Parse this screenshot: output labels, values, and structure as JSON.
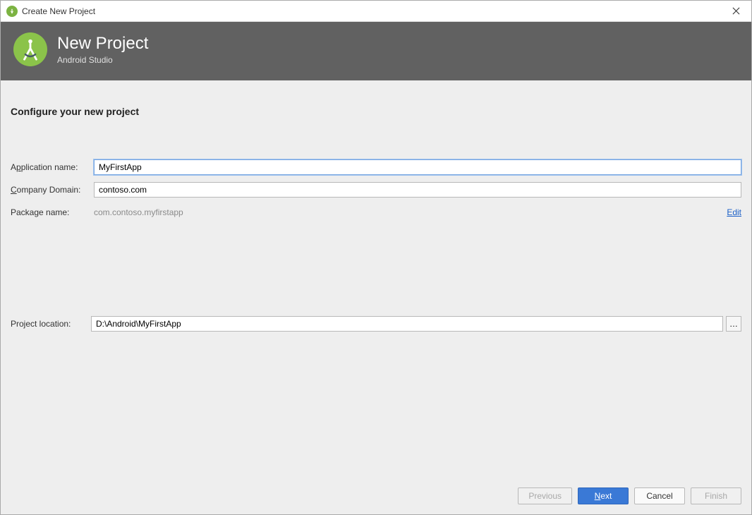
{
  "window": {
    "title": "Create New Project"
  },
  "header": {
    "title": "New Project",
    "subtitle": "Android Studio"
  },
  "section_title": "Configure your new project",
  "fields": {
    "app_name": {
      "label_pre": "A",
      "label_ul": "p",
      "label_post": "plication name:",
      "value": "MyFirstApp"
    },
    "company": {
      "label_ul": "C",
      "label_post": "ompany Domain:",
      "value": "contoso.com"
    },
    "package": {
      "label": "Package name:",
      "value": "com.contoso.myfirstapp",
      "edit": "Edit"
    },
    "location": {
      "label": "Project location:",
      "value": "D:\\Android\\MyFirstApp",
      "browse": "…"
    }
  },
  "footer": {
    "previous": "Previous",
    "next_ul": "N",
    "next_post": "ext",
    "cancel": "Cancel",
    "finish": "Finish"
  }
}
